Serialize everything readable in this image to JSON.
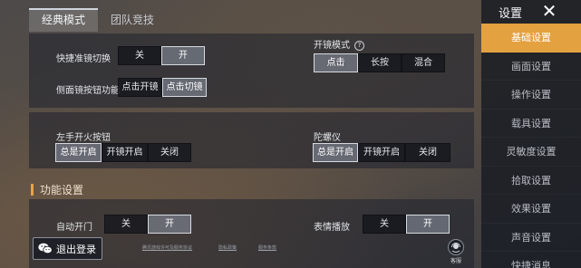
{
  "tabs": [
    {
      "label": "经典模式",
      "active": true
    },
    {
      "label": "团队竞技",
      "active": false
    }
  ],
  "quick_scope": {
    "label": "快捷准镜切换",
    "options": [
      "关",
      "开"
    ],
    "selected": "开"
  },
  "side_scope": {
    "label": "侧面镜按钮功能",
    "options": [
      "点击开镜",
      "点击切镜"
    ],
    "selected": "点击切镜"
  },
  "scope_mode": {
    "label": "开镜模式",
    "help": "?",
    "options": [
      "点击",
      "长按",
      "混合"
    ],
    "selected": "点击"
  },
  "left_fire": {
    "label": "左手开火按钮",
    "options": [
      "总是开启",
      "开镜开启",
      "关闭"
    ],
    "selected": "总是开启"
  },
  "gyro": {
    "label": "陀螺仪",
    "options": [
      "总是开启",
      "开镜开启",
      "关闭"
    ],
    "selected": "总是开启"
  },
  "section": {
    "title": "功能设置",
    "accent": "#e8a247"
  },
  "auto_door": {
    "label": "自动开门",
    "options": [
      "关",
      "开"
    ],
    "selected": "开"
  },
  "emote": {
    "label": "表情播放",
    "options": [
      "关",
      "开"
    ],
    "selected": "开"
  },
  "logout": {
    "label": "退出登录",
    "icon": "wechat-icon"
  },
  "footer_links": [
    "腾讯游戏许可及服务协议",
    "隐私政策",
    "服务条款"
  ],
  "service": {
    "label": "客服",
    "icon": "customer-service-icon"
  },
  "menu": {
    "title": "设置",
    "close_icon": "close-icon",
    "accent": "#e4a140",
    "items": [
      "基础设置",
      "画面设置",
      "操作设置",
      "载具设置",
      "灵敏度设置",
      "拾取设置",
      "效果设置",
      "声音设置",
      "快捷消息"
    ],
    "active_index": 0
  }
}
